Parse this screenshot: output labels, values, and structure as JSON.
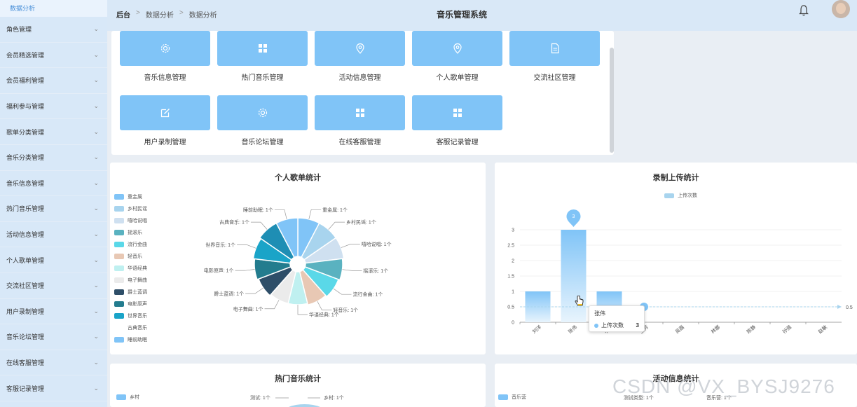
{
  "sidebar": {
    "active": "数据分析",
    "items": [
      "角色管理",
      "会员精选管理",
      "会员福利管理",
      "福利参与管理",
      "歌单分类管理",
      "音乐分类管理",
      "音乐信息管理",
      "热门音乐管理",
      "活动信息管理",
      "个人歌单管理",
      "交流社区管理",
      "用户录制管理",
      "音乐论坛管理",
      "在线客服管理",
      "客服记录管理"
    ]
  },
  "header": {
    "breadcrumb": [
      "后台",
      "数据分析",
      "数据分析"
    ],
    "title": "音乐管理系统"
  },
  "menu_tiles": [
    {
      "label": "音乐信息管理",
      "icon": "gear-icon"
    },
    {
      "label": "热门音乐管理",
      "icon": "grid-icon"
    },
    {
      "label": "活动信息管理",
      "icon": "location-pin-icon"
    },
    {
      "label": "个人歌单管理",
      "icon": "location-pin-icon"
    },
    {
      "label": "交流社区管理",
      "icon": "document-icon"
    },
    {
      "label": "用户录制管理",
      "icon": "edit-icon"
    },
    {
      "label": "音乐论坛管理",
      "icon": "gear-icon"
    },
    {
      "label": "在线客服管理",
      "icon": "grid-icon"
    },
    {
      "label": "客服记录管理",
      "icon": "grid-icon"
    }
  ],
  "colors": {
    "accent": "#80c4f7",
    "sidebar": "#d8e8f8",
    "header": "#d9e8f7"
  },
  "chart_data": [
    {
      "type": "pie",
      "title": "个人歌单统计",
      "categories": [
        "重金属",
        "乡村民谣",
        "嘻哈说唱",
        "摇滚乐",
        "流行金曲",
        "轻音乐",
        "华语经典",
        "电子舞曲",
        "爵士蓝调",
        "电影原声",
        "世界音乐",
        "古典音乐",
        "睡前助眠"
      ],
      "values": [
        1,
        1,
        1,
        1,
        1,
        1,
        1,
        1,
        1,
        1,
        1,
        1,
        1
      ],
      "colors": [
        "#80c4f7",
        "#a8d4ee",
        "#cfe0f0",
        "#5ab2c0",
        "#5ad8e8",
        "#e8c8b4",
        "#bff0f0",
        "#ebebeb",
        "#2e4e68",
        "#237c8e",
        "#1aa4c8",
        "#1e8eb4",
        "#80c4f7"
      ],
      "data_labels": [
        "重金属: 1个",
        "乡村民谣: 1个",
        "嘻哈说唱: 1个",
        "摇滚乐: 1个",
        "流行金曲: 1个",
        "轻音乐: 1个",
        "华语经典: 1个",
        "电子舞曲: 1个",
        "爵士蓝调: 1个",
        "电影原声: 1个",
        "世界音乐: 1个",
        "古典音乐: 1个",
        "睡前助眠: 1个"
      ]
    },
    {
      "type": "bar",
      "title": "录制上传统计",
      "legend": "上传次数",
      "categories": [
        "刘洋",
        "张伟",
        "李明",
        "王芳",
        "吴磊",
        "林娜",
        "陈静",
        "孙强",
        "赵敏"
      ],
      "values": [
        1,
        3,
        1,
        0.5,
        0.5,
        0.5,
        0.5,
        0.5,
        0.5
      ],
      "ylim": [
        0,
        3
      ],
      "yticks": [
        "0",
        "0.5",
        "1",
        "1.5",
        "2",
        "2.5",
        "3"
      ],
      "markline": {
        "value": 0.5,
        "label": "0.5"
      },
      "max_marker": "3",
      "tooltip": {
        "name": "张伟",
        "series": "上传次数",
        "value": "3"
      }
    },
    {
      "type": "pie",
      "title": "热门音乐统计",
      "legend_first": "乡村",
      "data_labels": [
        "测试: 1个",
        "乡村: 1个"
      ]
    },
    {
      "type": "pie",
      "title": "活动信息统计",
      "legend_first": "音乐营",
      "data_labels": [
        "测试类型: 1个",
        "音乐营: 1个"
      ]
    }
  ],
  "watermark": "CSDN @VX_BYSJ9276"
}
